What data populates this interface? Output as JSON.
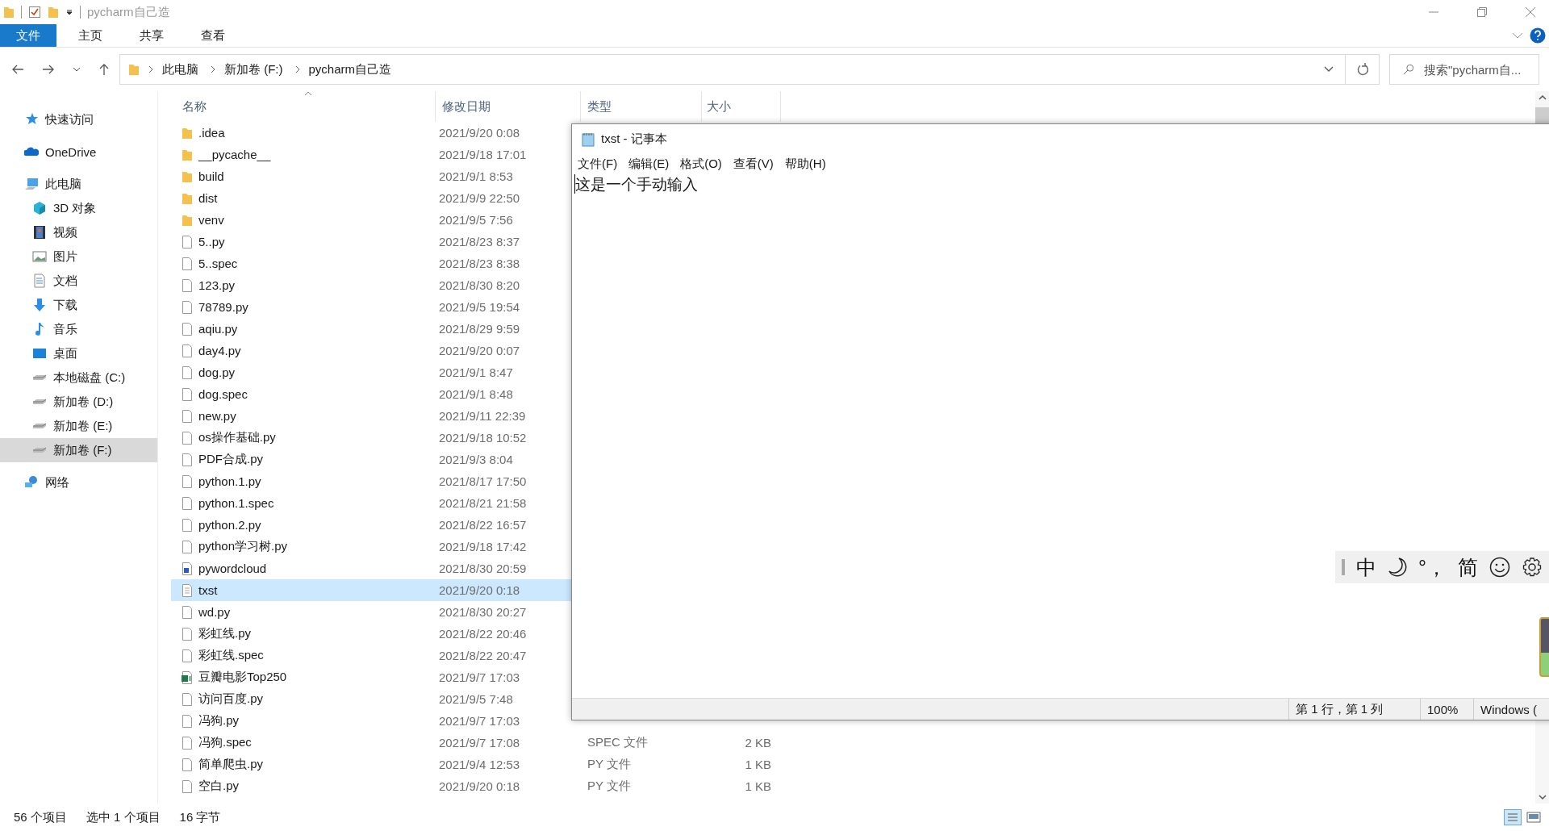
{
  "explorer": {
    "title": "pycharm自己造",
    "ribbon_tabs": [
      {
        "label": "文件",
        "kind": "file",
        "selected": false
      },
      {
        "label": "主页",
        "kind": "tab",
        "selected": false
      },
      {
        "label": "共享",
        "kind": "tab",
        "selected": false
      },
      {
        "label": "查看",
        "kind": "tab",
        "selected": false
      }
    ],
    "breadcrumb": [
      "此电脑",
      "新加卷 (F:)",
      "pycharm自己造"
    ],
    "search": {
      "placeholder": "搜索\"pycharm自..."
    },
    "sidebar": [
      {
        "label": "快速访问",
        "kind": "star",
        "selected": false
      },
      {
        "label": "OneDrive",
        "kind": "cloud",
        "selected": false
      },
      {
        "label": "此电脑",
        "kind": "pc",
        "selected": false,
        "children": [
          {
            "label": "3D 对象",
            "kind": "cube",
            "selected": false
          },
          {
            "label": "视频",
            "kind": "video",
            "selected": false
          },
          {
            "label": "图片",
            "kind": "image",
            "selected": false
          },
          {
            "label": "文档",
            "kind": "doc",
            "selected": false
          },
          {
            "label": "下载",
            "kind": "download",
            "selected": false
          },
          {
            "label": "音乐",
            "kind": "music",
            "selected": false
          },
          {
            "label": "桌面",
            "kind": "desktop",
            "selected": false
          },
          {
            "label": "本地磁盘 (C:)",
            "kind": "drive",
            "selected": false
          },
          {
            "label": "新加卷 (D:)",
            "kind": "drive",
            "selected": false
          },
          {
            "label": "新加卷 (E:)",
            "kind": "drive",
            "selected": false
          },
          {
            "label": "新加卷 (F:)",
            "kind": "drive",
            "selected": true
          }
        ]
      },
      {
        "label": "网络",
        "kind": "network",
        "selected": false
      }
    ],
    "columns": [
      "名称",
      "修改日期",
      "类型",
      "大小"
    ],
    "rows": [
      {
        "name": ".idea",
        "date": "2021/9/20 0:08",
        "kind": "folder",
        "selected": false
      },
      {
        "name": "__pycache__",
        "date": "2021/9/18 17:01",
        "kind": "folder",
        "selected": false
      },
      {
        "name": "build",
        "date": "2021/9/1 8:53",
        "kind": "folder",
        "selected": false
      },
      {
        "name": "dist",
        "date": "2021/9/9 22:50",
        "kind": "folder",
        "selected": false
      },
      {
        "name": "venv",
        "date": "2021/9/5 7:56",
        "kind": "folder",
        "selected": false
      },
      {
        "name": "5..py",
        "date": "2021/8/23 8:37",
        "kind": "file",
        "selected": false
      },
      {
        "name": "5..spec",
        "date": "2021/8/23 8:38",
        "kind": "file",
        "selected": false
      },
      {
        "name": "123.py",
        "date": "2021/8/30 8:20",
        "kind": "file",
        "selected": false
      },
      {
        "name": "78789.py",
        "date": "2021/9/5 19:54",
        "kind": "file",
        "selected": false
      },
      {
        "name": "aqiu.py",
        "date": "2021/8/29 9:59",
        "kind": "file",
        "selected": false
      },
      {
        "name": "day4.py",
        "date": "2021/9/20 0:07",
        "kind": "file",
        "selected": false
      },
      {
        "name": "dog.py",
        "date": "2021/9/1 8:47",
        "kind": "file",
        "selected": false
      },
      {
        "name": "dog.spec",
        "date": "2021/9/1 8:48",
        "kind": "file",
        "selected": false
      },
      {
        "name": "new.py",
        "date": "2021/9/11 22:39",
        "kind": "file",
        "selected": false
      },
      {
        "name": "os操作基础.py",
        "date": "2021/9/18 10:52",
        "kind": "file",
        "selected": false
      },
      {
        "name": "PDF合成.py",
        "date": "2021/9/3 8:04",
        "kind": "file",
        "selected": false
      },
      {
        "name": "python.1.py",
        "date": "2021/8/17 17:50",
        "kind": "file",
        "selected": false
      },
      {
        "name": "python.1.spec",
        "date": "2021/8/21 21:58",
        "kind": "file",
        "selected": false
      },
      {
        "name": "python.2.py",
        "date": "2021/8/22 16:57",
        "kind": "file",
        "selected": false
      },
      {
        "name": "python学习树.py",
        "date": "2021/9/18 17:42",
        "kind": "file",
        "selected": false
      },
      {
        "name": "pywordcloud",
        "date": "2021/8/30 20:59",
        "kind": "app",
        "selected": false
      },
      {
        "name": "txst",
        "date": "2021/9/20 0:18",
        "kind": "text",
        "selected": true
      },
      {
        "name": "wd.py",
        "date": "2021/8/30 20:27",
        "kind": "file",
        "selected": false
      },
      {
        "name": "彩虹线.py",
        "date": "2021/8/22 20:46",
        "kind": "file",
        "selected": false
      },
      {
        "name": "彩虹线.spec",
        "date": "2021/8/22 20:47",
        "kind": "file",
        "selected": false
      },
      {
        "name": "豆瓣电影Top250",
        "date": "2021/9/7 17:03",
        "kind": "sheet",
        "selected": false
      },
      {
        "name": "访问百度.py",
        "date": "2021/9/5 7:48",
        "kind": "file",
        "selected": false
      },
      {
        "name": "冯狗.py",
        "date": "2021/9/7 17:03",
        "kind": "file",
        "selected": false
      },
      {
        "name": "冯狗.spec",
        "date": "2021/9/7 17:08",
        "type": "SPEC 文件",
        "size": "2 KB",
        "kind": "file",
        "selected": false
      },
      {
        "name": "简单爬虫.py",
        "date": "2021/9/4 12:53",
        "type": "PY 文件",
        "size": "1 KB",
        "kind": "file",
        "selected": false
      },
      {
        "name": "空白.py",
        "date": "2021/9/20 0:18",
        "type": "PY 文件",
        "size": "1 KB",
        "kind": "file",
        "selected": false
      }
    ],
    "status": [
      "56 个项目",
      "选中 1 个项目",
      "16 字节"
    ]
  },
  "notepad": {
    "title": "txst - 记事本",
    "menu": [
      "文件(F)",
      "编辑(E)",
      "格式(O)",
      "查看(V)",
      "帮助(H)"
    ],
    "content": "这是一个手动输入",
    "status": [
      "第 1 行，第 1 列",
      "100%",
      "Windows ("
    ]
  },
  "ime_toolbar": [
    {
      "kind": "text",
      "text": "中"
    },
    {
      "kind": "moon"
    },
    {
      "kind": "text",
      "text": "°，"
    },
    {
      "kind": "text",
      "text": "简"
    },
    {
      "kind": "smiley"
    },
    {
      "kind": "gear"
    }
  ]
}
